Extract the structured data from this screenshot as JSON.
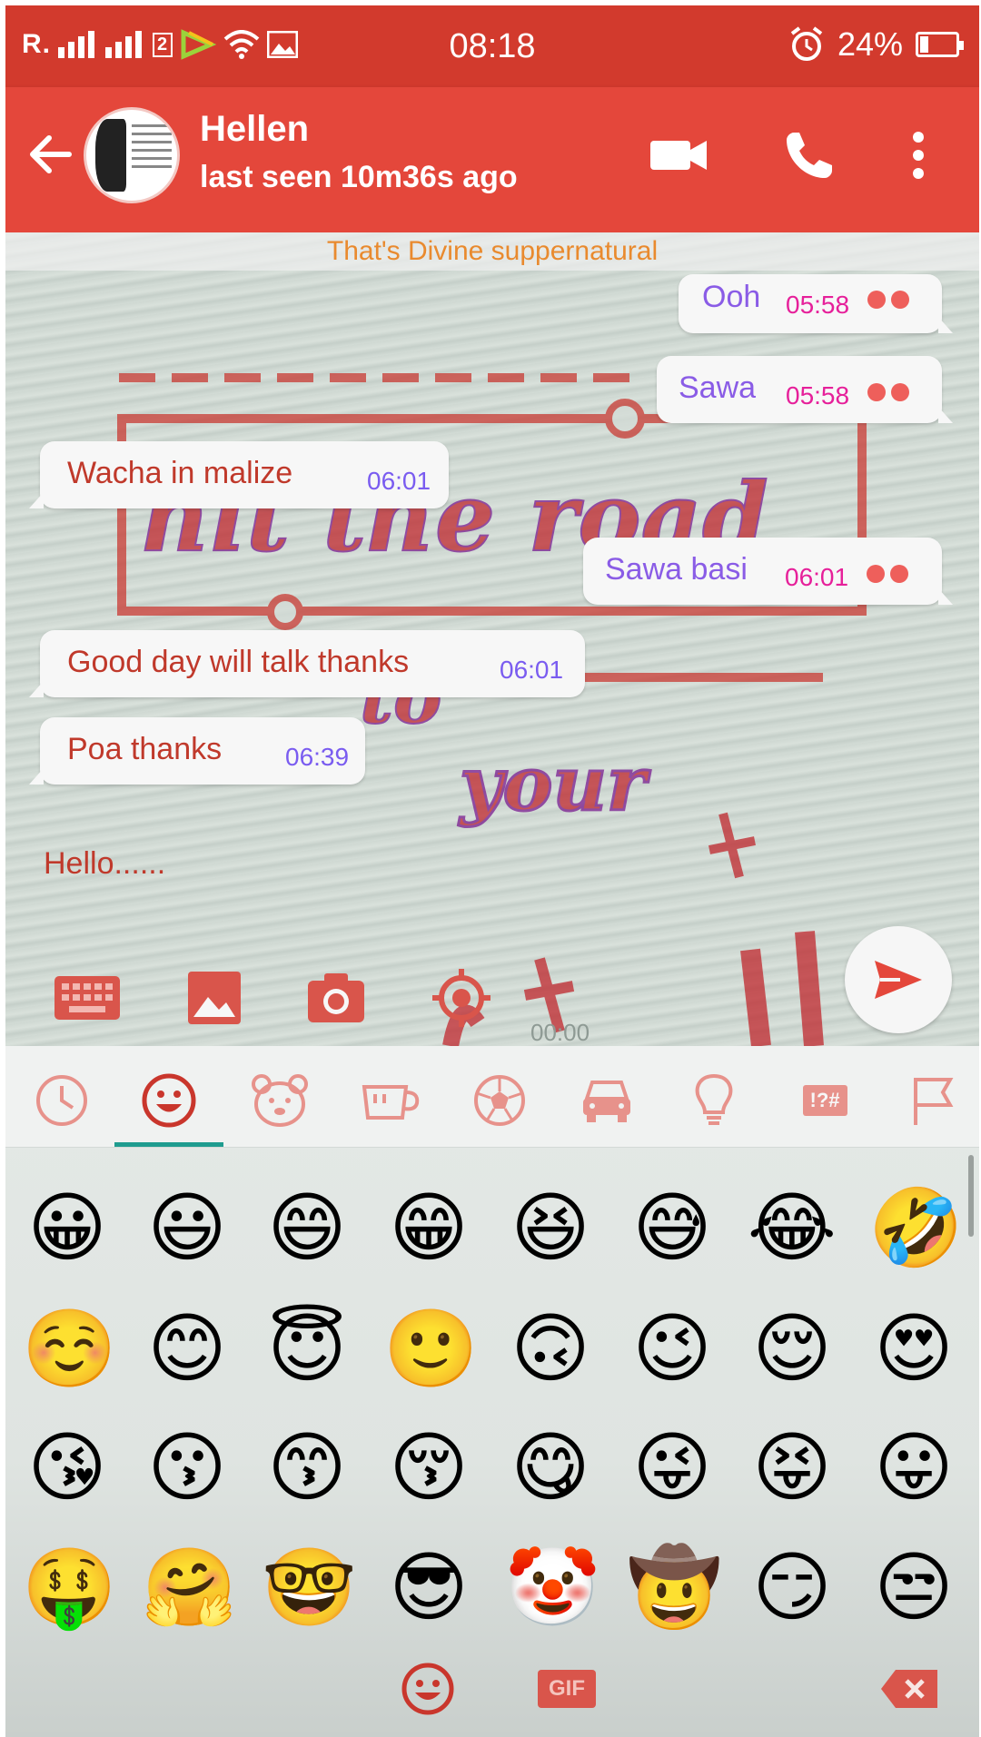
{
  "status": {
    "carrier_text": "R.",
    "sim2_label": "2",
    "time": "08:18",
    "battery_percent": "24%",
    "battery_level": 0.24
  },
  "contact": {
    "name": "Hellen",
    "last_seen": "last seen 10m36s ago"
  },
  "chat": {
    "pinned_text": "That's Divine suppernatural",
    "messages": [
      {
        "direction": "out",
        "text": "Ooh",
        "time": "05:58"
      },
      {
        "direction": "out",
        "text": "Sawa",
        "time": "05:58"
      },
      {
        "direction": "in",
        "text": "Wacha in malize",
        "time": "06:01"
      },
      {
        "direction": "out",
        "text": "Sawa basi",
        "time": "06:01"
      },
      {
        "direction": "in",
        "text": "Good day will talk thanks",
        "time": "06:01"
      },
      {
        "direction": "in",
        "text": "Poa thanks",
        "time": "06:39"
      }
    ],
    "wallpaper_words": [
      "hit the road",
      "to",
      "your"
    ],
    "compose_text": "Hello......",
    "record_timer": "00:00"
  },
  "keyboard": {
    "categories": [
      "recent-icon",
      "smileys-icon",
      "animals-icon",
      "food-icon",
      "activity-icon",
      "travel-icon",
      "objects-icon",
      "symbols-icon",
      "flags-icon"
    ],
    "symbols_label": "!?#",
    "gif_label": "GIF",
    "emoji_rows": [
      [
        "😀",
        "😃",
        "😄",
        "😁",
        "😆",
        "😅",
        "😂",
        "🤣"
      ],
      [
        "☺️",
        "😊",
        "😇",
        "🙂",
        "🙃",
        "😉",
        "😌",
        "😍"
      ],
      [
        "😘",
        "😗",
        "😙",
        "😚",
        "😋",
        "😜",
        "😝",
        "😛"
      ],
      [
        "🤑",
        "🤗",
        "🤓",
        "😎",
        "🤡",
        "🤠",
        "😏",
        "😒"
      ]
    ]
  },
  "colors": {
    "statusbar": "#d23a2d",
    "appbar": "#e4473b",
    "accent_red": "#e4473b",
    "tab_underline": "#1f9c8f"
  }
}
